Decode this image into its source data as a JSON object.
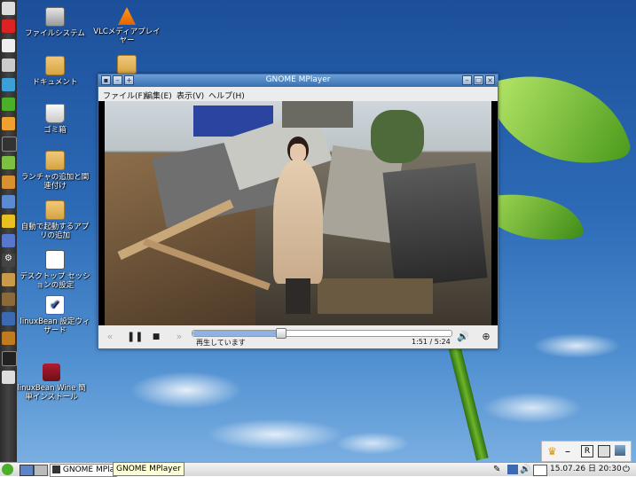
{
  "desktop": {
    "icons": [
      {
        "label": "ファイルシステム",
        "icon": "drive-icon"
      },
      {
        "label": "VLCメディアプレイヤー",
        "icon": "vlc-icon"
      },
      {
        "label": "ドキュメント",
        "icon": "folder-icon"
      },
      {
        "label": "ゴミ箱",
        "icon": "trash-icon"
      },
      {
        "label": "ランチャの追加と関連付け",
        "icon": "folder-icon"
      },
      {
        "label": "自動で起動するアプリの追加",
        "icon": "folder-icon"
      },
      {
        "label": "デスクトップ セッションの設定",
        "icon": "blank-file-icon"
      },
      {
        "label": "linuxBean 設定ウィザード",
        "icon": "checkbox-icon"
      },
      {
        "label": "linuxBean Wine 簡単インストール",
        "icon": "wine-icon"
      }
    ]
  },
  "window": {
    "title": "GNOME MPlayer",
    "menus": [
      "ファイル(F)",
      "編集(E)",
      "表示(V)",
      "ヘルプ(H)"
    ],
    "status": "再生しています",
    "time_current": "1:51",
    "time_sep": "/",
    "time_total": "5:24",
    "progress": 0.34
  },
  "taskbar": {
    "task_label": "GNOME MPlayer",
    "tooltip": "GNOME MPlayer",
    "clock": "15.07.26 日 20:30"
  },
  "tray_widget": {
    "r_label": "R"
  }
}
